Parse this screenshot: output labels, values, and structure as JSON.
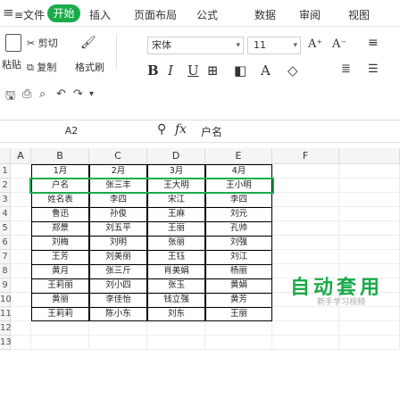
{
  "menubar": {
    "toggle_icon": "hamburger-icon",
    "file": "≡文件",
    "start": "开始",
    "items": [
      "插入",
      "页面布局",
      "公式",
      "数据",
      "审阅",
      "视图"
    ]
  },
  "ribbon": {
    "paste_label": "粘贴",
    "cut_label": "剪切",
    "copy_label": "复制",
    "format_painter_label": "格式刷",
    "font_name": "宋体",
    "font_size": "11",
    "font_grow": "A⁺",
    "font_shrink": "A⁻",
    "bold": "B",
    "italic": "I",
    "underline": "U",
    "border_icon": "border-icon",
    "fill_icon": "fill-color-icon",
    "font_color_icon": "font-color-icon",
    "eraser_icon": "clear-format-icon"
  },
  "quick_access": {
    "icons": [
      "save-icon",
      "print-icon",
      "print-preview-icon",
      "undo-icon",
      "redo-icon",
      "customize-icon"
    ]
  },
  "formula_bar": {
    "cell_ref": "A2",
    "zoom_icon": "zoom-icon",
    "fx_label": "fx",
    "value": "户名"
  },
  "sheet": {
    "columns": [
      "A",
      "B",
      "C",
      "D",
      "E",
      "F"
    ],
    "rows": [
      "1",
      "2",
      "3",
      "4",
      "5",
      "6",
      "7",
      "8",
      "9",
      "10",
      "11",
      "12",
      "13"
    ],
    "header": [
      "1月",
      "2月",
      "3月",
      "4月"
    ],
    "data": [
      [
        "户名",
        "张三丰",
        "王大明",
        "王小明"
      ],
      [
        "姓名表",
        "李四",
        "宋江",
        "李四"
      ],
      [
        "鲁迅",
        "孙俊",
        "王麻",
        "刘元"
      ],
      [
        "郑景",
        "刘五平",
        "王丽",
        "孔帅"
      ],
      [
        "刘梅",
        "刘明",
        "张丽",
        "刘强"
      ],
      [
        "王芳",
        "刘美丽",
        "王钰",
        "刘江"
      ],
      [
        "黄月",
        "张三斤",
        "肖美娟",
        "杨丽"
      ],
      [
        "王莉丽",
        "刘小四",
        "张玉",
        "黄娟"
      ],
      [
        "黄丽",
        "李佳怡",
        "钱立强",
        "黄芳"
      ],
      [
        "王莉莉",
        "陈小东",
        "刘东",
        "王丽"
      ]
    ],
    "side_text": "自动套用",
    "side_caption": "新手学习视频"
  },
  "colors": {
    "accent": "#1aab49",
    "table_border": "#000000",
    "header_bg": "#f5f5f5"
  }
}
